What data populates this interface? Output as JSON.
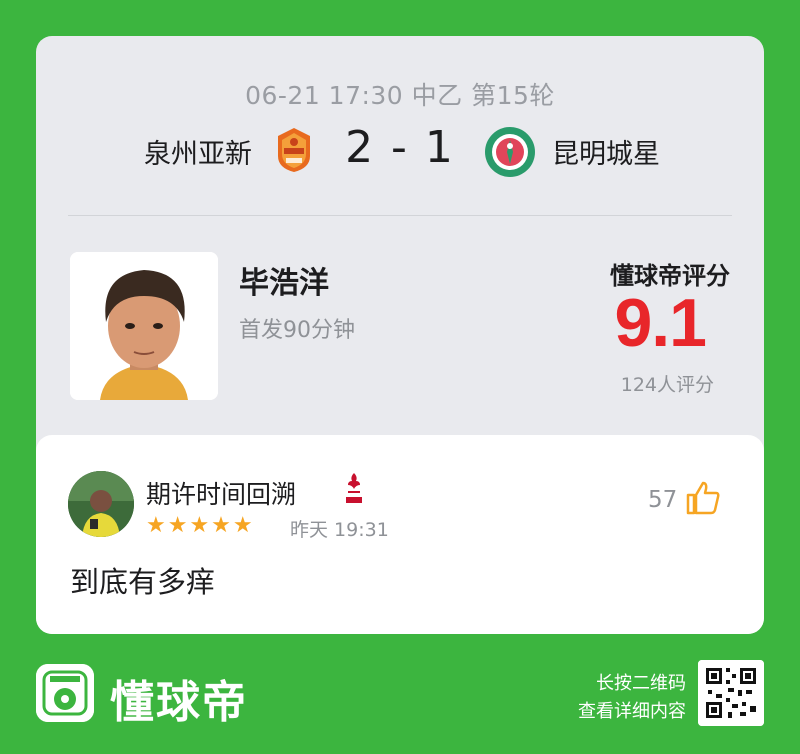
{
  "match": {
    "info": "06-21 17:30 中乙 第15轮",
    "home_team": "泉州亚新",
    "away_team": "昆明城星",
    "score": "2 - 1"
  },
  "player": {
    "name": "毕浩洋",
    "subtitle": "首发90分钟"
  },
  "rating": {
    "title": "懂球帝评分",
    "value": "9.1",
    "count": "124人评分"
  },
  "comment": {
    "username": "期许时间回溯",
    "stars": "★★★★★",
    "time": "昨天 19:31",
    "likes": "57",
    "text": "到底有多痒"
  },
  "footer": {
    "brand": "懂球帝",
    "line1": "长按二维码",
    "line2": "查看详细内容"
  },
  "colors": {
    "background": "#3cb53f",
    "rating": "#e8262a",
    "stars": "#f6a523"
  }
}
